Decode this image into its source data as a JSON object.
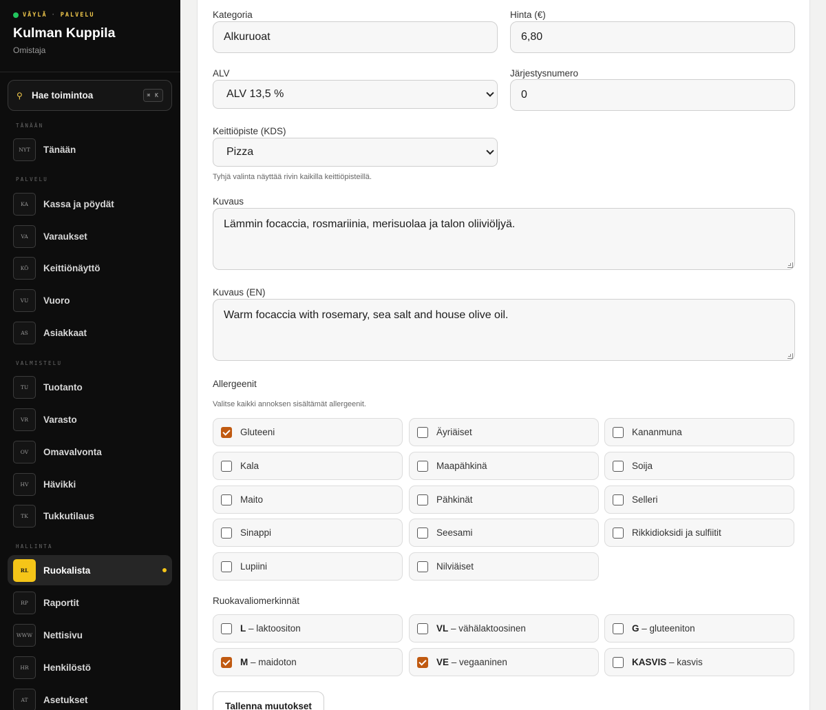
{
  "sidebar": {
    "brand_tag_1": "VÄYLÄ",
    "brand_tag_sep": "·",
    "brand_tag_2": "PALVELU",
    "venue_name": "Kulman Kuppila",
    "role": "Omistaja",
    "search_label": "Hae toimintoa",
    "search_shortcut": "⌘ K",
    "sections": {
      "today": "TÄNÄÄN",
      "service": "PALVELU",
      "prep": "VALMISTELU",
      "admin": "HALLINTA"
    },
    "items": [
      {
        "abbr": "NYT",
        "label": "Tänään"
      },
      {
        "abbr": "KA",
        "label": "Kassa ja pöydät"
      },
      {
        "abbr": "VA",
        "label": "Varaukset"
      },
      {
        "abbr": "KÖ",
        "label": "Keittiönäyttö"
      },
      {
        "abbr": "VU",
        "label": "Vuoro"
      },
      {
        "abbr": "AS",
        "label": "Asiakkaat"
      },
      {
        "abbr": "TU",
        "label": "Tuotanto"
      },
      {
        "abbr": "VR",
        "label": "Varasto"
      },
      {
        "abbr": "OV",
        "label": "Omavalvonta"
      },
      {
        "abbr": "HV",
        "label": "Hävikki"
      },
      {
        "abbr": "TK",
        "label": "Tukkutilaus"
      },
      {
        "abbr": "RL",
        "label": "Ruokalista"
      },
      {
        "abbr": "RP",
        "label": "Raportit"
      },
      {
        "abbr": "WWW",
        "label": "Nettisivu"
      },
      {
        "abbr": "HR",
        "label": "Henkilöstö"
      },
      {
        "abbr": "AT",
        "label": "Asetukset"
      }
    ],
    "active_item": "Ruokalista",
    "accent_color": "#f5c518"
  },
  "form": {
    "category": {
      "label": "Kategoria",
      "value": "Alkuruoat"
    },
    "price": {
      "label": "Hinta (€)",
      "value": "6,80"
    },
    "vat": {
      "label": "ALV",
      "value": "ALV 13,5 %"
    },
    "order": {
      "label": "Järjestysnumero",
      "value": "0"
    },
    "station": {
      "label": "Keittiöpiste (KDS)",
      "value": "Pizza",
      "hint": "Tyhjä valinta näyttää rivin kaikilla keittiöpisteillä."
    },
    "description": {
      "label": "Kuvaus",
      "value": "Lämmin focaccia, rosmariinia, merisuolaa ja talon oliiviöljyä."
    },
    "description_en": {
      "label": "Kuvaus (EN)",
      "value": "Warm focaccia with rosemary, sea salt and house olive oil."
    },
    "allergens": {
      "label": "Allergeenit",
      "hint": "Valitse kaikki annoksen sisältämät allergeenit.",
      "options": [
        {
          "label": "Gluteeni",
          "checked": true
        },
        {
          "label": "Äyriäiset",
          "checked": false
        },
        {
          "label": "Kananmuna",
          "checked": false
        },
        {
          "label": "Kala",
          "checked": false
        },
        {
          "label": "Maapähkinä",
          "checked": false
        },
        {
          "label": "Soija",
          "checked": false
        },
        {
          "label": "Maito",
          "checked": false
        },
        {
          "label": "Pähkinät",
          "checked": false
        },
        {
          "label": "Selleri",
          "checked": false
        },
        {
          "label": "Sinappi",
          "checked": false
        },
        {
          "label": "Seesami",
          "checked": false
        },
        {
          "label": "Rikkidioksidi ja sulfiitit",
          "checked": false
        },
        {
          "label": "Lupiini",
          "checked": false
        },
        {
          "label": "Nilviäiset",
          "checked": false
        }
      ]
    },
    "diet": {
      "label": "Ruokavaliomerkinnät",
      "options": [
        {
          "code": "L",
          "text": " – laktoositon",
          "checked": false
        },
        {
          "code": "VL",
          "text": " – vähälaktoosinen",
          "checked": false
        },
        {
          "code": "G",
          "text": " – gluteeniton",
          "checked": false
        },
        {
          "code": "M",
          "text": " – maidoton",
          "checked": true
        },
        {
          "code": "VE",
          "text": " – vegaaninen",
          "checked": true
        },
        {
          "code": "KASVIS",
          "text": " – kasvis",
          "checked": false
        }
      ]
    },
    "save_label": "Tallenna muutokset",
    "check_color": "#c05a11"
  }
}
